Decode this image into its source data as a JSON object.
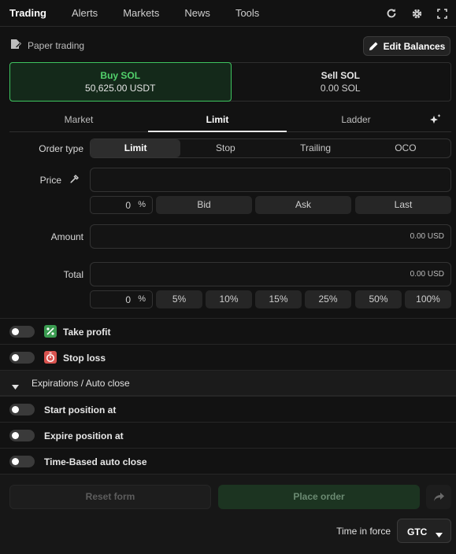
{
  "nav": {
    "tabs": [
      "Trading",
      "Alerts",
      "Markets",
      "News",
      "Tools"
    ],
    "icons": [
      "refresh-icon",
      "gear-icon",
      "fullscreen-icon"
    ]
  },
  "account": {
    "mode_label": "Paper trading",
    "edit_balances_label": "Edit Balances"
  },
  "side": {
    "buy": {
      "title": "Buy SOL",
      "value": "50,625.00 USDT"
    },
    "sell": {
      "title": "Sell SOL",
      "value": "0.00 SOL"
    }
  },
  "order_tabs": [
    "Market",
    "Limit",
    "Ladder"
  ],
  "order_type": {
    "label": "Order type",
    "options": [
      "Limit",
      "Stop",
      "Trailing",
      "OCO"
    ]
  },
  "price": {
    "label": "Price",
    "offset_value": "0",
    "offset_unit": "%",
    "quick_buttons": [
      "Bid",
      "Ask",
      "Last"
    ]
  },
  "amount": {
    "label": "Amount",
    "value": "0.00 USD"
  },
  "total": {
    "label": "Total",
    "value": "0.00 USD",
    "pct_value": "0",
    "pct_unit": "%",
    "presets": [
      "5%",
      "10%",
      "15%",
      "25%",
      "50%",
      "100%"
    ]
  },
  "toggles": {
    "take_profit": "Take profit",
    "stop_loss": "Stop loss",
    "expirations_title": "Expirations / Auto close",
    "start_position": "Start position at",
    "expire_position": "Expire position at",
    "time_based": "Time-Based auto close"
  },
  "footer": {
    "reset_label": "Reset form",
    "place_label": "Place order",
    "tif_label": "Time in force",
    "tif_value": "GTC"
  },
  "colors": {
    "accent_green": "#3ec45f",
    "take_profit_badge": "#3a9b50",
    "stop_loss_badge": "#d9534f"
  }
}
